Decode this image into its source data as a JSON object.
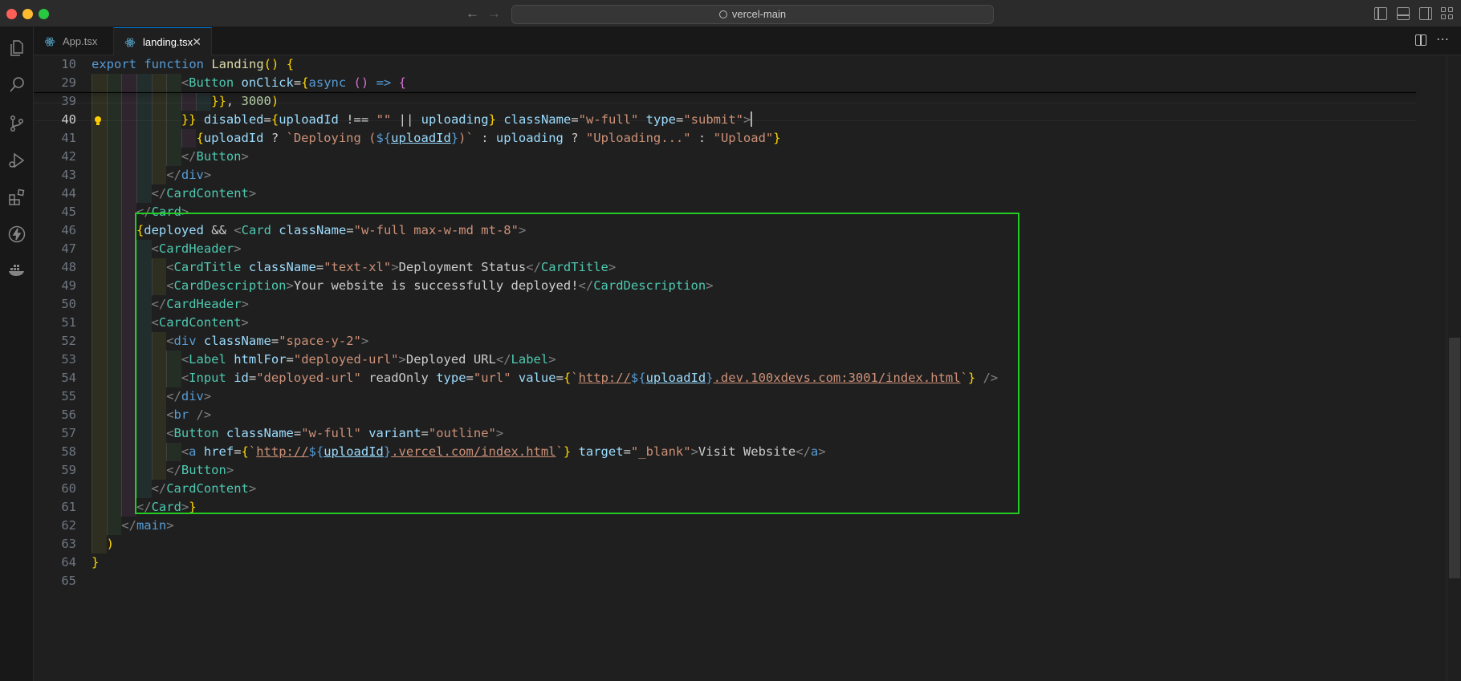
{
  "window": {
    "search_label": "vercel-main"
  },
  "tabs": [
    {
      "label": "App.tsx",
      "active": false
    },
    {
      "label": "landing.tsx",
      "active": true
    }
  ],
  "colors": {
    "accent": "#0078d4",
    "highlight_box": "#22cc22"
  },
  "activity_icons": [
    "explorer-icon",
    "search-icon",
    "source-control-icon",
    "run-debug-icon",
    "extensions-icon",
    "lightning-icon",
    "docker-icon"
  ],
  "editor": {
    "active_line": 40,
    "lines": [
      {
        "n": "10",
        "text": "export function Landing() {"
      },
      {
        "n": "29",
        "text": "<Button onClick={async () => {"
      },
      {
        "n": "39",
        "text": "}}, 3000)"
      },
      {
        "n": "40",
        "text": "}} disabled={uploadId !== \"\" || uploading} className=\"w-full\" type=\"submit\">"
      },
      {
        "n": "41",
        "text": "{uploadId ? `Deploying (${uploadId})` : uploading ? \"Uploading...\" : \"Upload\"}"
      },
      {
        "n": "42",
        "text": "</Button>"
      },
      {
        "n": "43",
        "text": "</div>"
      },
      {
        "n": "44",
        "text": "</CardContent>"
      },
      {
        "n": "45",
        "text": "</Card>"
      },
      {
        "n": "46",
        "text": "{deployed && <Card className=\"w-full max-w-md mt-8\">"
      },
      {
        "n": "47",
        "text": "<CardHeader>"
      },
      {
        "n": "48",
        "text": "<CardTitle className=\"text-xl\">Deployment Status</CardTitle>"
      },
      {
        "n": "49",
        "text": "<CardDescription>Your website is successfully deployed!</CardDescription>"
      },
      {
        "n": "50",
        "text": "</CardHeader>"
      },
      {
        "n": "51",
        "text": "<CardContent>"
      },
      {
        "n": "52",
        "text": "<div className=\"space-y-2\">"
      },
      {
        "n": "53",
        "text": "<Label htmlFor=\"deployed-url\">Deployed URL</Label>"
      },
      {
        "n": "54",
        "text": "<Input id=\"deployed-url\" readOnly type=\"url\" value={`http://${uploadId}.dev.100xdevs.com:3001/index.html`} />"
      },
      {
        "n": "55",
        "text": "</div>"
      },
      {
        "n": "56",
        "text": "<br />"
      },
      {
        "n": "57",
        "text": "<Button className=\"w-full\" variant=\"outline\">"
      },
      {
        "n": "58",
        "text": "<a href={`http://${uploadId}.vercel.com/index.html`} target=\"_blank\">Visit Website</a>"
      },
      {
        "n": "59",
        "text": "</Button>"
      },
      {
        "n": "60",
        "text": "</CardContent>"
      },
      {
        "n": "61",
        "text": "</Card>}"
      },
      {
        "n": "62",
        "text": "</main>"
      },
      {
        "n": "63",
        "text": ")"
      },
      {
        "n": "64",
        "text": "}"
      },
      {
        "n": "65",
        "text": ""
      }
    ]
  }
}
